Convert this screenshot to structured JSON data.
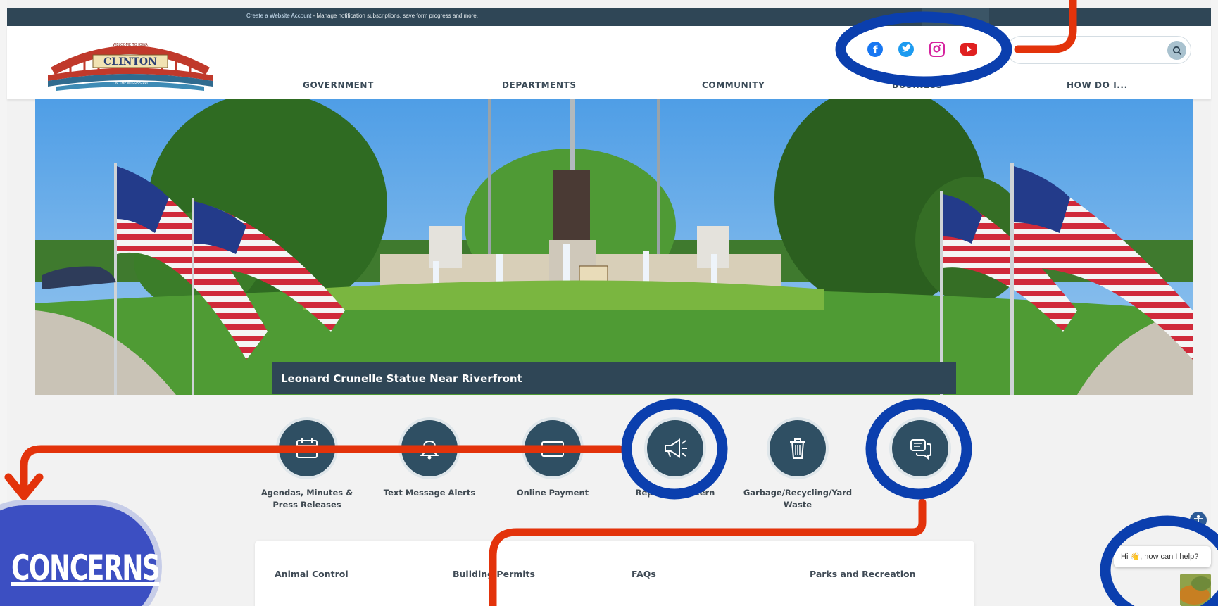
{
  "topbar": {
    "link_text": "Create a Website Account",
    "message": " - Manage notification subscriptions, save form progress and more."
  },
  "logo": {
    "text": "CLINTON",
    "arch_top": "WELCOME TO IOWA",
    "arch_bottom": "ON THE MISSISSIPPI"
  },
  "nav": [
    {
      "label": "GOVERNMENT"
    },
    {
      "label": "DEPARTMENTS"
    },
    {
      "label": "COMMUNITY"
    },
    {
      "label": "BUSINESS"
    },
    {
      "label": "HOW DO I..."
    }
  ],
  "social": [
    {
      "icon": "facebook-icon",
      "color": "#1877f2"
    },
    {
      "icon": "twitter-icon",
      "color": "#1d9bf0"
    },
    {
      "icon": "instagram-icon",
      "color": "#d6249f"
    },
    {
      "icon": "youtube-icon",
      "color": "#e02020"
    }
  ],
  "search": {
    "placeholder": "",
    "icon": "search-icon"
  },
  "hero": {
    "caption": "Leonard Crunelle Statue Near Riverfront"
  },
  "quick_links": [
    {
      "label": "Agendas, Minutes & Press Releases",
      "icon": "calendar-icon"
    },
    {
      "label": "Text Message Alerts",
      "icon": "bell-icon"
    },
    {
      "label": "Online Payment",
      "icon": "credit-card-icon"
    },
    {
      "label": "Report a Concern",
      "icon": "megaphone-icon"
    },
    {
      "label": "Garbage/Recycling/Yard Waste",
      "icon": "trash-icon"
    },
    {
      "label": "Feedback",
      "icon": "chat-bubbles-icon"
    }
  ],
  "bottom_links": [
    {
      "label": "Animal Control"
    },
    {
      "label": "Building Permits"
    },
    {
      "label": "FAQs"
    },
    {
      "label": "Parks and Recreation"
    }
  ],
  "concerns_badge": {
    "text": "CONCERNS"
  },
  "chat": {
    "greeting": "Hi 👋, how can I help?"
  },
  "colors": {
    "header_dark": "#2f4656",
    "annotation_blue": "#0b3fae",
    "annotation_red": "#e3330b",
    "badge_blue": "#3c4fc2"
  }
}
